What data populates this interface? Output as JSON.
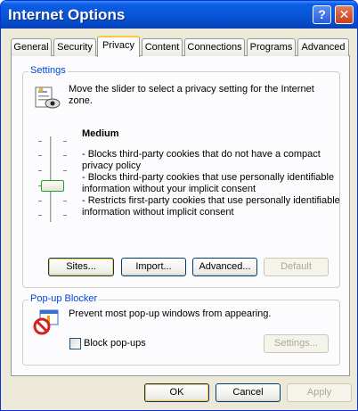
{
  "window": {
    "title": "Internet Options"
  },
  "titlebar": {
    "help_glyph": "?",
    "close_glyph": "✕"
  },
  "tabs": [
    {
      "label": "General"
    },
    {
      "label": "Security"
    },
    {
      "label": "Privacy",
      "active": true
    },
    {
      "label": "Content"
    },
    {
      "label": "Connections"
    },
    {
      "label": "Programs"
    },
    {
      "label": "Advanced"
    }
  ],
  "settings": {
    "group_label": "Settings",
    "intro": [
      "Move the slider to select a privacy setting for the Internet",
      "zone."
    ],
    "icon": "privacy-settings-icon",
    "slider_level_fraction": 0.5,
    "level_name": "Medium",
    "description_lines": [
      "- Blocks third-party cookies that do not have a compact",
      "privacy policy",
      "- Blocks third-party cookies that use personally identifiable",
      "information without your implicit consent",
      "- Restricts first-party cookies that use personally identifiable",
      "information without implicit consent"
    ],
    "buttons": {
      "sites": "Sites...",
      "import": "Import...",
      "advanced": "Advanced...",
      "default": "Default"
    }
  },
  "popup": {
    "group_label": "Pop-up Blocker",
    "icon": "popup-blocker-icon",
    "description": "Prevent most pop-up windows from appearing.",
    "checkbox_label": "Block pop-ups",
    "checkbox_checked": false,
    "settings_button": "Settings..."
  },
  "footer": {
    "ok": "OK",
    "cancel": "Cancel",
    "apply": "Apply"
  },
  "colors": {
    "title_blue": "#0a55d8",
    "group_label": "#0046d5",
    "tab_highlight": "#ffc83c"
  }
}
